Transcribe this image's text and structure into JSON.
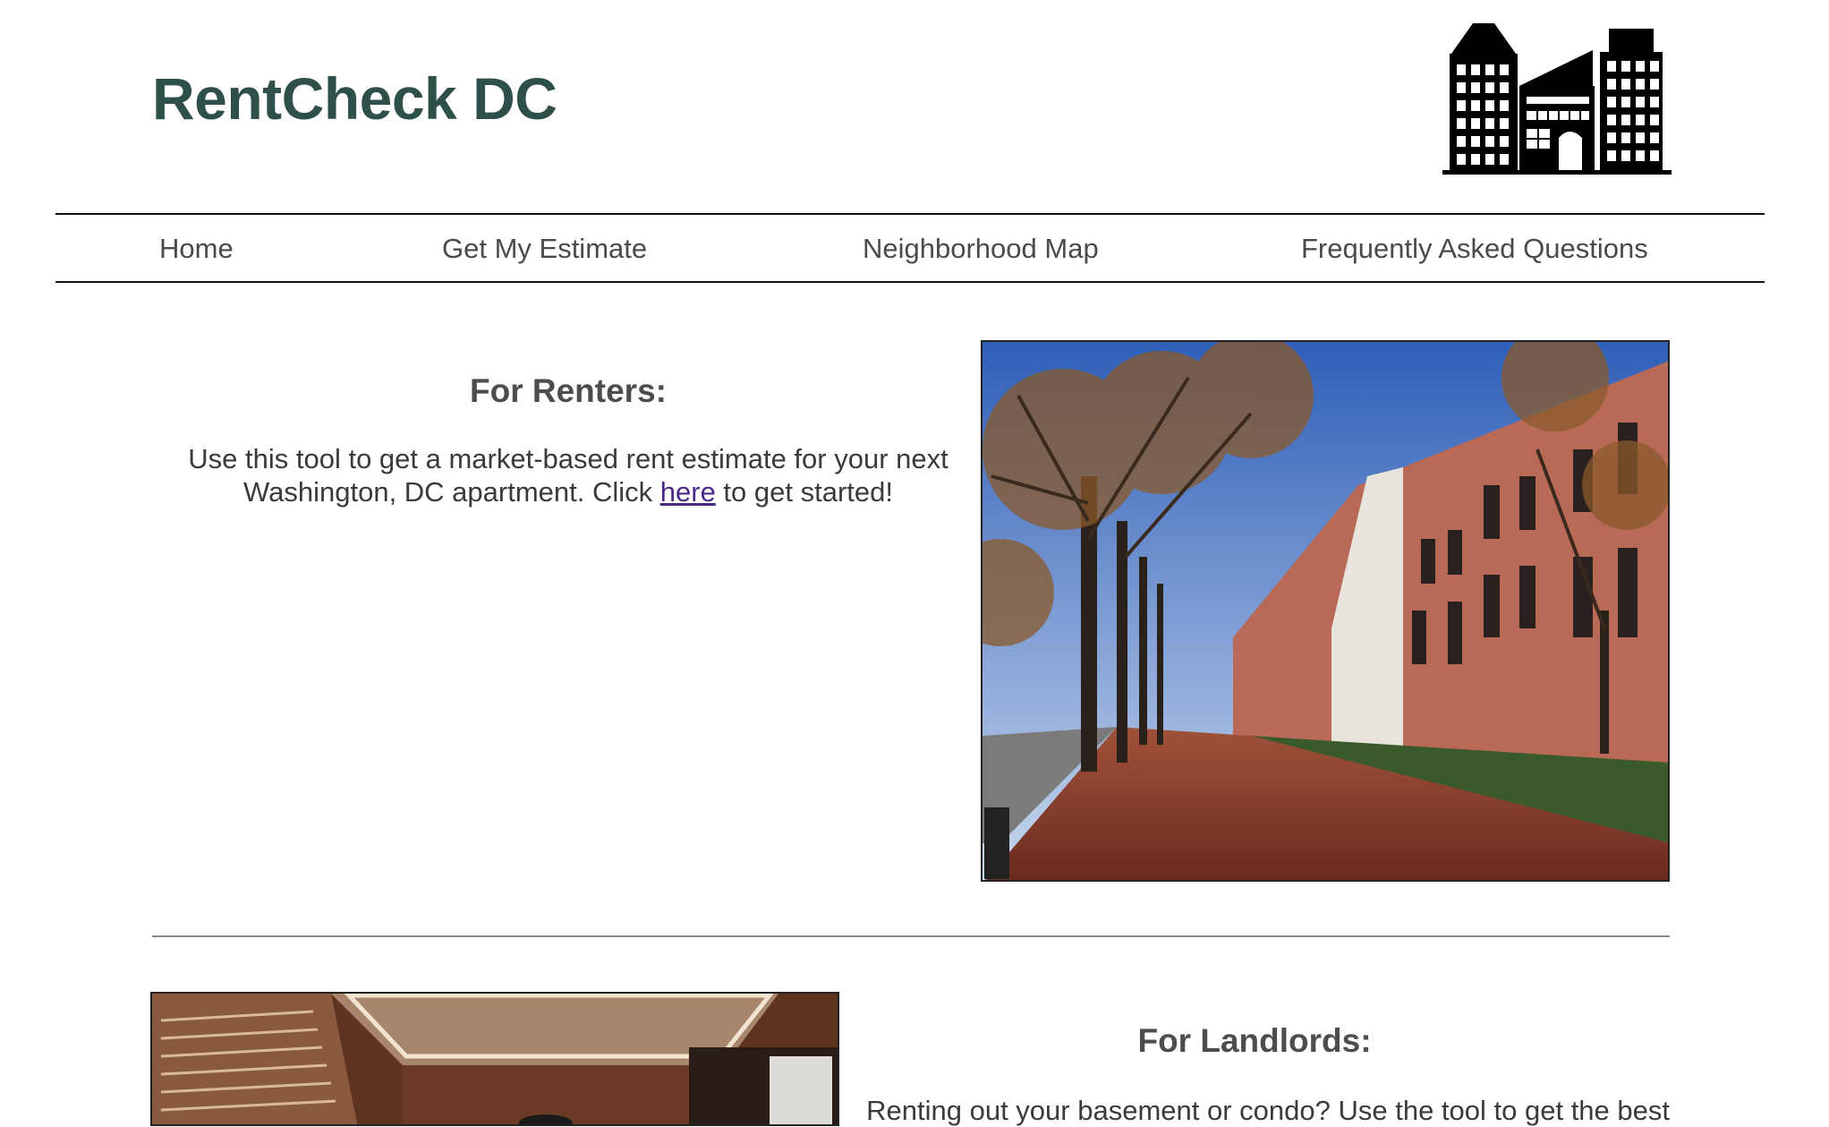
{
  "header": {
    "title": "RentCheck DC",
    "logo_icon": "city-buildings-icon"
  },
  "nav": {
    "items": [
      {
        "label": "Home"
      },
      {
        "label": "Get My Estimate"
      },
      {
        "label": "Neighborhood Map"
      },
      {
        "label": "Frequently Asked Questions"
      }
    ]
  },
  "renters": {
    "heading": "For Renters:",
    "text_before": "Use this tool to get a market-based rent estimate for your next Washington, DC apartment. Click ",
    "link_label": "here",
    "text_after": " to get started!"
  },
  "landlords": {
    "heading": "For Landlords:",
    "text": "Renting out your basement or condo? Use the tool to get the best"
  },
  "colors": {
    "title": "#2f4f4a",
    "link": "#4b2a87",
    "text": "#3a3a3a"
  }
}
